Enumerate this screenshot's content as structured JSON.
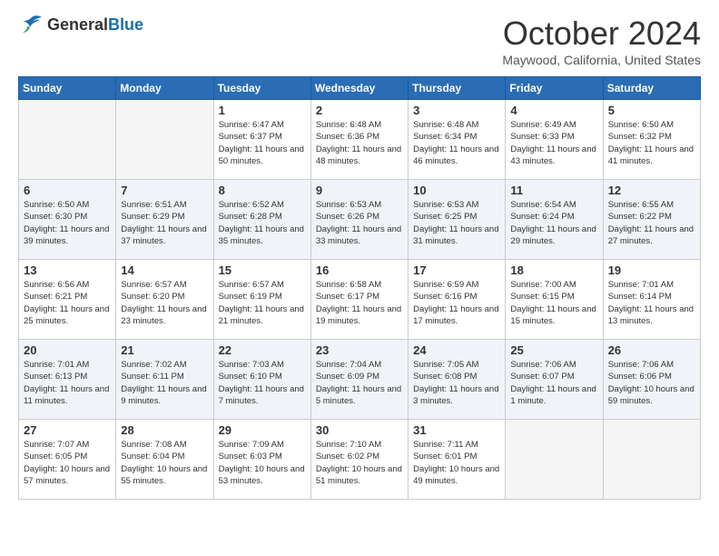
{
  "header": {
    "logo_general": "General",
    "logo_blue": "Blue",
    "month_title": "October 2024",
    "location": "Maywood, California, United States"
  },
  "days_of_week": [
    "Sunday",
    "Monday",
    "Tuesday",
    "Wednesday",
    "Thursday",
    "Friday",
    "Saturday"
  ],
  "weeks": [
    [
      {
        "day": "",
        "info": ""
      },
      {
        "day": "",
        "info": ""
      },
      {
        "day": "1",
        "info": "Sunrise: 6:47 AM\nSunset: 6:37 PM\nDaylight: 11 hours and 50 minutes."
      },
      {
        "day": "2",
        "info": "Sunrise: 6:48 AM\nSunset: 6:36 PM\nDaylight: 11 hours and 48 minutes."
      },
      {
        "day": "3",
        "info": "Sunrise: 6:48 AM\nSunset: 6:34 PM\nDaylight: 11 hours and 46 minutes."
      },
      {
        "day": "4",
        "info": "Sunrise: 6:49 AM\nSunset: 6:33 PM\nDaylight: 11 hours and 43 minutes."
      },
      {
        "day": "5",
        "info": "Sunrise: 6:50 AM\nSunset: 6:32 PM\nDaylight: 11 hours and 41 minutes."
      }
    ],
    [
      {
        "day": "6",
        "info": "Sunrise: 6:50 AM\nSunset: 6:30 PM\nDaylight: 11 hours and 39 minutes."
      },
      {
        "day": "7",
        "info": "Sunrise: 6:51 AM\nSunset: 6:29 PM\nDaylight: 11 hours and 37 minutes."
      },
      {
        "day": "8",
        "info": "Sunrise: 6:52 AM\nSunset: 6:28 PM\nDaylight: 11 hours and 35 minutes."
      },
      {
        "day": "9",
        "info": "Sunrise: 6:53 AM\nSunset: 6:26 PM\nDaylight: 11 hours and 33 minutes."
      },
      {
        "day": "10",
        "info": "Sunrise: 6:53 AM\nSunset: 6:25 PM\nDaylight: 11 hours and 31 minutes."
      },
      {
        "day": "11",
        "info": "Sunrise: 6:54 AM\nSunset: 6:24 PM\nDaylight: 11 hours and 29 minutes."
      },
      {
        "day": "12",
        "info": "Sunrise: 6:55 AM\nSunset: 6:22 PM\nDaylight: 11 hours and 27 minutes."
      }
    ],
    [
      {
        "day": "13",
        "info": "Sunrise: 6:56 AM\nSunset: 6:21 PM\nDaylight: 11 hours and 25 minutes."
      },
      {
        "day": "14",
        "info": "Sunrise: 6:57 AM\nSunset: 6:20 PM\nDaylight: 11 hours and 23 minutes."
      },
      {
        "day": "15",
        "info": "Sunrise: 6:57 AM\nSunset: 6:19 PM\nDaylight: 11 hours and 21 minutes."
      },
      {
        "day": "16",
        "info": "Sunrise: 6:58 AM\nSunset: 6:17 PM\nDaylight: 11 hours and 19 minutes."
      },
      {
        "day": "17",
        "info": "Sunrise: 6:59 AM\nSunset: 6:16 PM\nDaylight: 11 hours and 17 minutes."
      },
      {
        "day": "18",
        "info": "Sunrise: 7:00 AM\nSunset: 6:15 PM\nDaylight: 11 hours and 15 minutes."
      },
      {
        "day": "19",
        "info": "Sunrise: 7:01 AM\nSunset: 6:14 PM\nDaylight: 11 hours and 13 minutes."
      }
    ],
    [
      {
        "day": "20",
        "info": "Sunrise: 7:01 AM\nSunset: 6:13 PM\nDaylight: 11 hours and 11 minutes."
      },
      {
        "day": "21",
        "info": "Sunrise: 7:02 AM\nSunset: 6:11 PM\nDaylight: 11 hours and 9 minutes."
      },
      {
        "day": "22",
        "info": "Sunrise: 7:03 AM\nSunset: 6:10 PM\nDaylight: 11 hours and 7 minutes."
      },
      {
        "day": "23",
        "info": "Sunrise: 7:04 AM\nSunset: 6:09 PM\nDaylight: 11 hours and 5 minutes."
      },
      {
        "day": "24",
        "info": "Sunrise: 7:05 AM\nSunset: 6:08 PM\nDaylight: 11 hours and 3 minutes."
      },
      {
        "day": "25",
        "info": "Sunrise: 7:06 AM\nSunset: 6:07 PM\nDaylight: 11 hours and 1 minute."
      },
      {
        "day": "26",
        "info": "Sunrise: 7:06 AM\nSunset: 6:06 PM\nDaylight: 10 hours and 59 minutes."
      }
    ],
    [
      {
        "day": "27",
        "info": "Sunrise: 7:07 AM\nSunset: 6:05 PM\nDaylight: 10 hours and 57 minutes."
      },
      {
        "day": "28",
        "info": "Sunrise: 7:08 AM\nSunset: 6:04 PM\nDaylight: 10 hours and 55 minutes."
      },
      {
        "day": "29",
        "info": "Sunrise: 7:09 AM\nSunset: 6:03 PM\nDaylight: 10 hours and 53 minutes."
      },
      {
        "day": "30",
        "info": "Sunrise: 7:10 AM\nSunset: 6:02 PM\nDaylight: 10 hours and 51 minutes."
      },
      {
        "day": "31",
        "info": "Sunrise: 7:11 AM\nSunset: 6:01 PM\nDaylight: 10 hours and 49 minutes."
      },
      {
        "day": "",
        "info": ""
      },
      {
        "day": "",
        "info": ""
      }
    ]
  ]
}
